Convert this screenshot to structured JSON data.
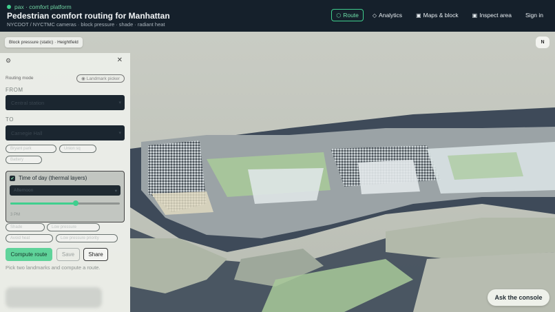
{
  "header": {
    "brand": "pax · comfort platform",
    "title": "Pedestrian comfort routing for Manhattan",
    "subtitle": "NYCDOT / NYCTMC cameras · block pressure · shade · radiant heat",
    "nav": [
      {
        "label": "Route",
        "icon": "hexagon-icon",
        "glyph": "⬡",
        "active": true
      },
      {
        "label": "Analytics",
        "icon": "diamond-icon",
        "glyph": "◇",
        "active": false
      },
      {
        "label": "Maps & block",
        "icon": "square-icon",
        "glyph": "▣",
        "active": false
      },
      {
        "label": "Inspect area",
        "icon": "square-icon",
        "glyph": "▣",
        "active": false
      },
      {
        "label": "Sign in",
        "icon": "",
        "glyph": "",
        "active": false
      }
    ]
  },
  "map": {
    "layer_pill": "Block pressure (static) · Heightfield",
    "compass": "N",
    "ask_button": "Ask the console"
  },
  "panel": {
    "routing_mode_label": "Routing mode",
    "landmark_picker": "Landmark picker",
    "from_label": "FROM",
    "from_value": "Central station",
    "to_label": "TO",
    "to_value": "Carnegie Hall",
    "chips_row1": [
      "Bryant park",
      "Union sq"
    ],
    "chips_row2": [
      "Battery"
    ],
    "time_of_day": {
      "checked": true,
      "title": "Time of day (thermal layers)",
      "select_value": "Afternoon",
      "slider_fraction": 0.6,
      "time_readout": "3 PM"
    },
    "chips_row3": [
      "Shade",
      "Low pressure"
    ],
    "chips_row4": [
      "Avoid heat",
      "Low pressure priority"
    ],
    "buttons": {
      "compute": "Compute route",
      "save": "Save",
      "share": "Share"
    },
    "hint": "Pick two landmarks and compute a route."
  },
  "colors": {
    "accent": "#3fcf8e",
    "header_bg": "#15202b",
    "land": "#c8cbc2",
    "water": "#3e4a59",
    "park": "#a8c99a"
  }
}
